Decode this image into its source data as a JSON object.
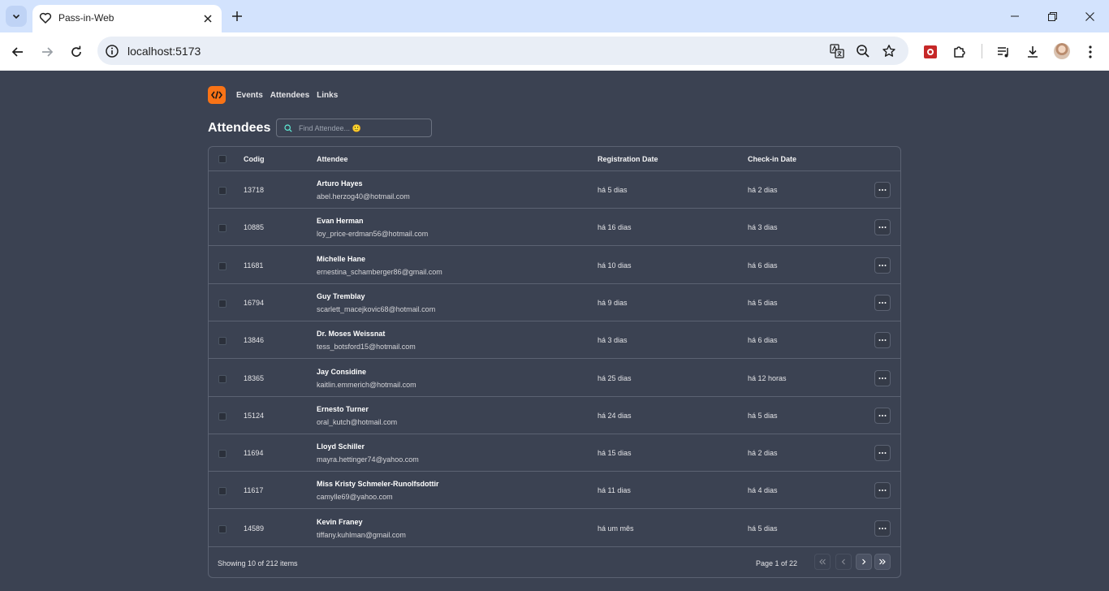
{
  "browser": {
    "tab_title": "Pass-in-Web",
    "url": "localhost:5173"
  },
  "app": {
    "nav": [
      "Events",
      "Attendees",
      "Links"
    ],
    "page_title": "Attendees",
    "search_placeholder": "Find Attendee... 🙂",
    "columns": {
      "code": "Codig",
      "attendee": "Attendee",
      "registration": "Registration Date",
      "checkin": "Check-in Date"
    },
    "rows": [
      {
        "code": "13718",
        "name": "Arturo Hayes",
        "email": "abel.herzog40@hotmail.com",
        "registered": "há 5 dias",
        "checkin": "há 2 dias"
      },
      {
        "code": "10885",
        "name": "Evan Herman",
        "email": "loy_price-erdman56@hotmail.com",
        "registered": "há 16 dias",
        "checkin": "há 3 dias"
      },
      {
        "code": "11681",
        "name": "Michelle Hane",
        "email": "ernestina_schamberger86@gmail.com",
        "registered": "há 10 dias",
        "checkin": "há 6 dias"
      },
      {
        "code": "16794",
        "name": "Guy Tremblay",
        "email": "scarlett_macejkovic68@hotmail.com",
        "registered": "há 9 dias",
        "checkin": "há 5 dias"
      },
      {
        "code": "13846",
        "name": "Dr. Moses Weissnat",
        "email": "tess_botsford15@hotmail.com",
        "registered": "há 3 dias",
        "checkin": "há 6 dias"
      },
      {
        "code": "18365",
        "name": "Jay Considine",
        "email": "kaitlin.emmerich@hotmail.com",
        "registered": "há 25 dias",
        "checkin": "há 12 horas"
      },
      {
        "code": "15124",
        "name": "Ernesto Turner",
        "email": "oral_kutch@hotmail.com",
        "registered": "há 24 dias",
        "checkin": "há 5 dias"
      },
      {
        "code": "11694",
        "name": "Lloyd Schiller",
        "email": "mayra.hettinger74@yahoo.com",
        "registered": "há 15 dias",
        "checkin": "há 2 dias"
      },
      {
        "code": "11617",
        "name": "Miss Kristy Schmeler-Runolfsdottir",
        "email": "camylle69@yahoo.com",
        "registered": "há 11 dias",
        "checkin": "há 4 dias"
      },
      {
        "code": "14589",
        "name": "Kevin Franey",
        "email": "tiffany.kuhlman@gmail.com",
        "registered": "há um mês",
        "checkin": "há 5 dias"
      }
    ],
    "footer": {
      "showing": "Showing 10 of 212 items",
      "page": "Page 1 of 22"
    }
  },
  "colors": {
    "background": "#3b4252",
    "accent": "#f97316",
    "border": "#5b6272"
  }
}
